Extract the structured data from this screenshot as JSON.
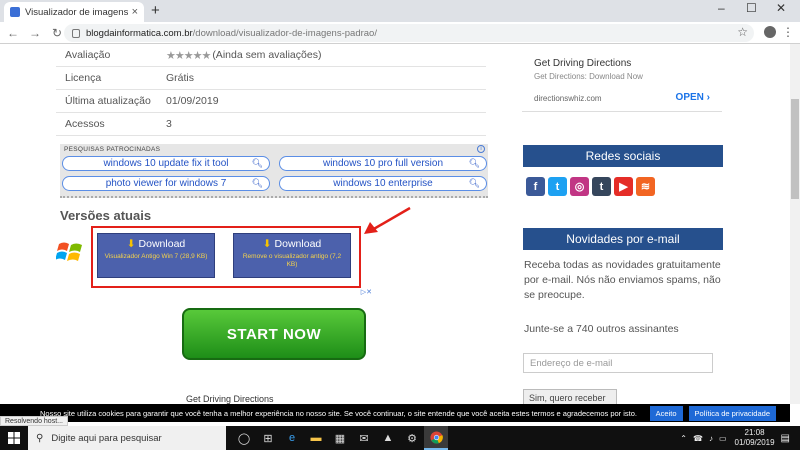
{
  "browser": {
    "tab_title": "Visualizador de imagens padrão",
    "tab_close": "×",
    "new_tab": "+",
    "url_host": "blogdainformatica.com.br",
    "url_path": "/download/visualizador-de-imagens-padrao/"
  },
  "info_table": [
    {
      "label": "Avaliação",
      "value": "(Ainda sem avaliações)"
    },
    {
      "label": "Licença",
      "value": "Grátis"
    },
    {
      "label": "Última atualização",
      "value": "01/09/2019"
    },
    {
      "label": "Acessos",
      "value": "3"
    }
  ],
  "rating": {
    "stars": "★★★★★"
  },
  "sponsored": {
    "header": "PESQUISAS PATROCINADAS",
    "pills": [
      "windows 10 update fix it tool",
      "windows 10 pro full version",
      "photo viewer for windows 7",
      "windows 10 enterprise"
    ]
  },
  "versions": {
    "heading": "Versões atuais",
    "downloads": [
      {
        "label": "Download",
        "sub": "Visualizador Antigo Win 7 (28,9 KB)"
      },
      {
        "label": "Download",
        "sub": "Remove o visualizador antigo (7,2 KB)"
      }
    ]
  },
  "ad_bottom": {
    "button": "START NOW",
    "peek": "Get Driving Directions"
  },
  "ad_top": {
    "title": "Get Driving Directions",
    "subtitle": "Get Directions: Download Now",
    "domain": "directionswhiz.com",
    "open": "OPEN"
  },
  "sidebar": {
    "social_title": "Redes sociais",
    "social_icons": [
      "f",
      "t",
      "◎",
      "t",
      "▶",
      "≋"
    ],
    "newsletter_title": "Novidades por e-mail",
    "newsletter_text": "Receba todas as novidades gratuitamente por e-mail. Nós não enviamos spams, não se preocupe.",
    "subscribers": "Junte-se a 740 outros assinantes",
    "email_placeholder": "Endereço de e-mail",
    "subscribe_button": "Sim, quero receber"
  },
  "cookie": {
    "message": "Nosso site utiliza cookies para garantir que você tenha a melhor experiência no nosso site. Se você continuar, o site entende que você aceita estes termos e agradecemos por isto.",
    "accept": "Aceito",
    "policy": "Política de privacidade"
  },
  "status_bar": "Resolvendo host...",
  "taskbar": {
    "search_placeholder": "Digite aqui para pesquisar",
    "time": "21:08",
    "date": "01/09/2019"
  },
  "colors": {
    "accent": "#26508d",
    "download_btn": "#4c61ac",
    "highlight": "#e32019"
  }
}
